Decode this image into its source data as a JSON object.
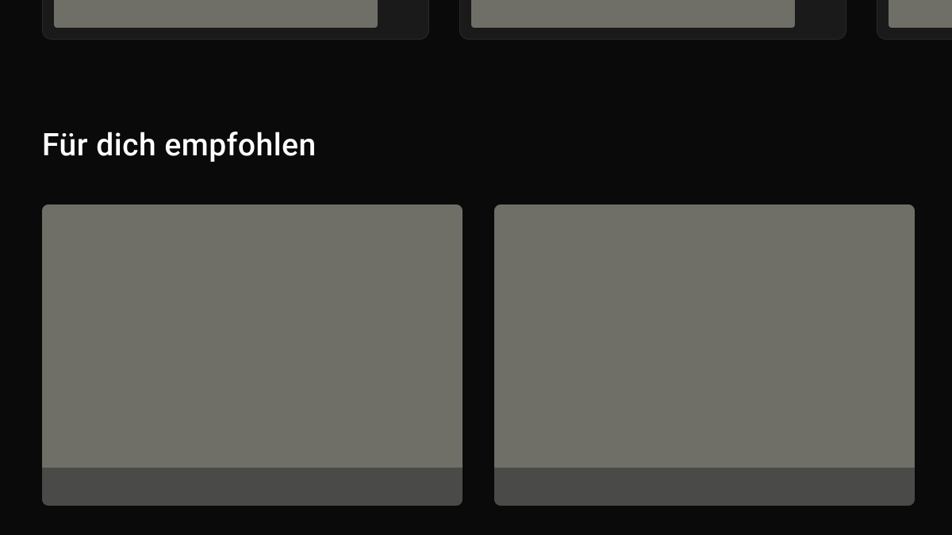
{
  "sections": {
    "recommended": {
      "title": "Für dich empfohlen"
    }
  }
}
